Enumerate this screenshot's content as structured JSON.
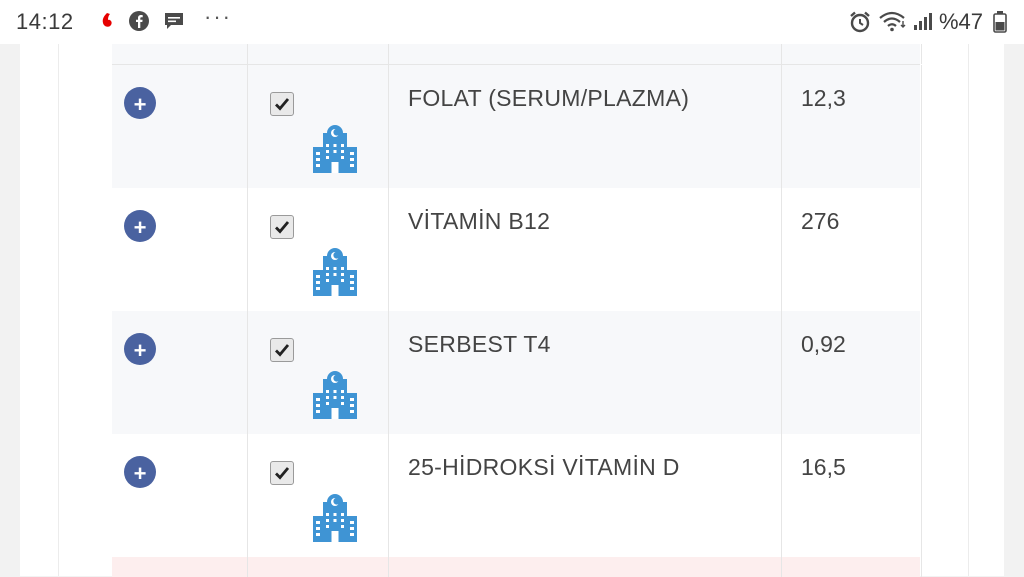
{
  "status_bar": {
    "time": "14:12",
    "dots": "···",
    "battery_text": "%47",
    "icons": [
      "vodafone-icon",
      "facebook-icon",
      "message-icon",
      "alarm-icon",
      "wifi-icon",
      "signal-icon",
      "battery-icon"
    ]
  },
  "colors": {
    "plus_button": "#4a62a0",
    "hospital_icon": "#3f94d4",
    "alert_row": "#fdeeee",
    "vodafone": "#e60000"
  },
  "results": [
    {
      "checked": true,
      "test": "FOLAT (SERUM/PLAZMA)",
      "value": "12,3"
    },
    {
      "checked": true,
      "test": "VİTAMİN B12",
      "value": "276"
    },
    {
      "checked": true,
      "test": "SERBEST T4",
      "value": "0,92"
    },
    {
      "checked": true,
      "test": "25-HİDROKSİ VİTAMİN D",
      "value": "16,5"
    }
  ],
  "expand_label": "+"
}
